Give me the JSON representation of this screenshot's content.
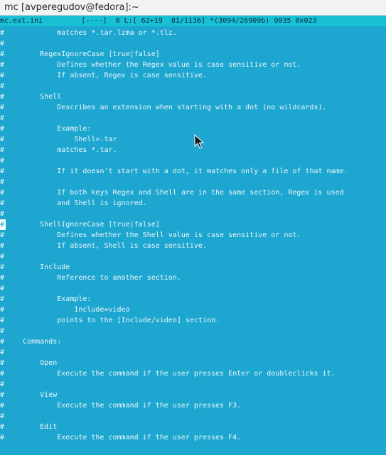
{
  "window": {
    "title": "mc [avperegudov@fedora]:~"
  },
  "status": {
    "text": "mc.ext.ini         [----]  0 L:[ 62+19  81/1136] *(3094/26909b) 0035 0x023"
  },
  "lines": [
    "#            matches *.tar.lzma or *.tlz.",
    "#",
    "#        RegexIgnoreCase [true|false]",
    "#            Defines whether the Regex value is case sensitive or not.",
    "#            If absent, Regex is case sensitive.",
    "#",
    "#        Shell",
    "#            Describes an extension when starting with a dot (no wildcards).",
    "#",
    "#            Example:",
    "#                Shell=.tar",
    "#            matches *.tar.",
    "#",
    "#            If it doesn't start with a dot, it matches only a file of that name.",
    "#",
    "#            If both keys Regex and Shell are in the same section, Regex is used",
    "#            and Shell is ignored.",
    "#",
    "#        ShellIgnoreCase [true|false]",
    "#            Defines whether the Shell value is case sensitive or not.",
    "#            If absent, Shell is case sensitive.",
    "#",
    "#        Include",
    "#            Reference to another section.",
    "#",
    "#            Example:",
    "#                Include=video",
    "#            points to the [Include/video] section.",
    "#",
    "#    Commands:",
    "#",
    "#        Open",
    "#            Execute the command if the user presses Enter or doubleclicks it.",
    "#",
    "#        View",
    "#            Execute the command if the user presses F3.",
    "#",
    "#        Edit",
    "#            Execute the command if the user presses F4."
  ],
  "cursor_line_index": 18,
  "colors": {
    "background": "#1da6d0",
    "status_bar": "#18c0d6",
    "title_bar": "#f3f3f3",
    "text": "#eef6fb"
  },
  "icons": {
    "pointer": "mouse-pointer-icon"
  }
}
